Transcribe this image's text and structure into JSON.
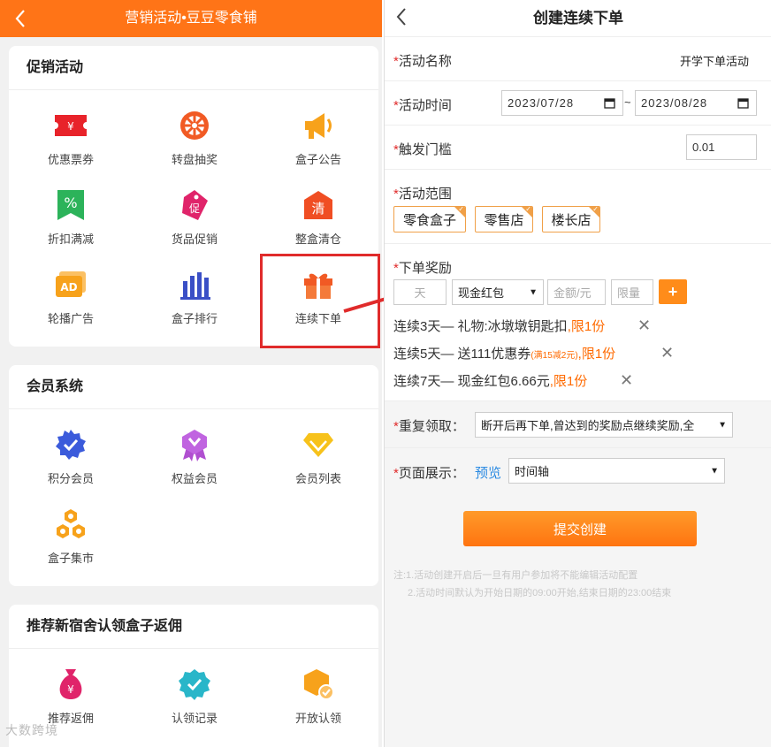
{
  "left": {
    "header": {
      "title": "营销活动•豆豆零食铺"
    },
    "sections": {
      "promo": {
        "title": "促销活动",
        "items": [
          "优惠票券",
          "转盘抽奖",
          "盒子公告",
          "折扣满减",
          "货品促销",
          "整盒清仓",
          "轮播广告",
          "盒子排行",
          "连续下单"
        ]
      },
      "member": {
        "title": "会员系统",
        "items": [
          "积分会员",
          "权益会员",
          "会员列表",
          "盒子集市"
        ]
      },
      "referral": {
        "title": "推荐新宿舍认领盒子返佣",
        "items": [
          "推荐返佣",
          "认领记录",
          "开放认领"
        ]
      }
    },
    "watermark": "大数跨境"
  },
  "right": {
    "header": {
      "title": "创建连续下单"
    },
    "form": {
      "activity_name": {
        "label": "活动名称",
        "value": "开学下单活动"
      },
      "activity_time": {
        "label": "活动时间",
        "start": "2023/07/28",
        "separator": "~",
        "end": "2023/08/28"
      },
      "trigger": {
        "label": "触发门槛",
        "value": "0.01"
      },
      "scope": {
        "label": "活动范围",
        "tags": [
          "零食盒子",
          "零售店",
          "楼长店"
        ]
      },
      "reward": {
        "label": "下单奖励",
        "days_placeholder": "天",
        "type_selected": "现金红包",
        "amount_placeholder": "金额/元",
        "limit_placeholder": "限量",
        "plus": "+",
        "lines": [
          {
            "text": "连续3天— 礼物:冰墩墩钥匙扣",
            "small": "",
            "limit": ",限1份"
          },
          {
            "text": "连续5天— 送111优惠券",
            "small": "(满15减2元)",
            "limit": ",限1份"
          },
          {
            "text": "连续7天— 现金红包6.66元",
            "small": "",
            "limit": ",限1份"
          }
        ],
        "delete_symbol": "✕"
      },
      "repeat": {
        "label": "重复领取：",
        "selected": "断开后再下单,曾达到的奖励点继续奖励,全"
      },
      "display": {
        "label": "页面展示：",
        "preview": "预览",
        "selected": "时间轴"
      }
    },
    "submit": "提交创建",
    "notes": [
      "注:1.活动创建开启后一旦有用户参加将不能编辑活动配置",
      "2.活动时间默认为开始日期的09:00开始,结束日期的23:00结束"
    ]
  },
  "colors": {
    "brand": "#ff7417",
    "required": "#e02b2b",
    "highlight": "#e02b2b"
  }
}
